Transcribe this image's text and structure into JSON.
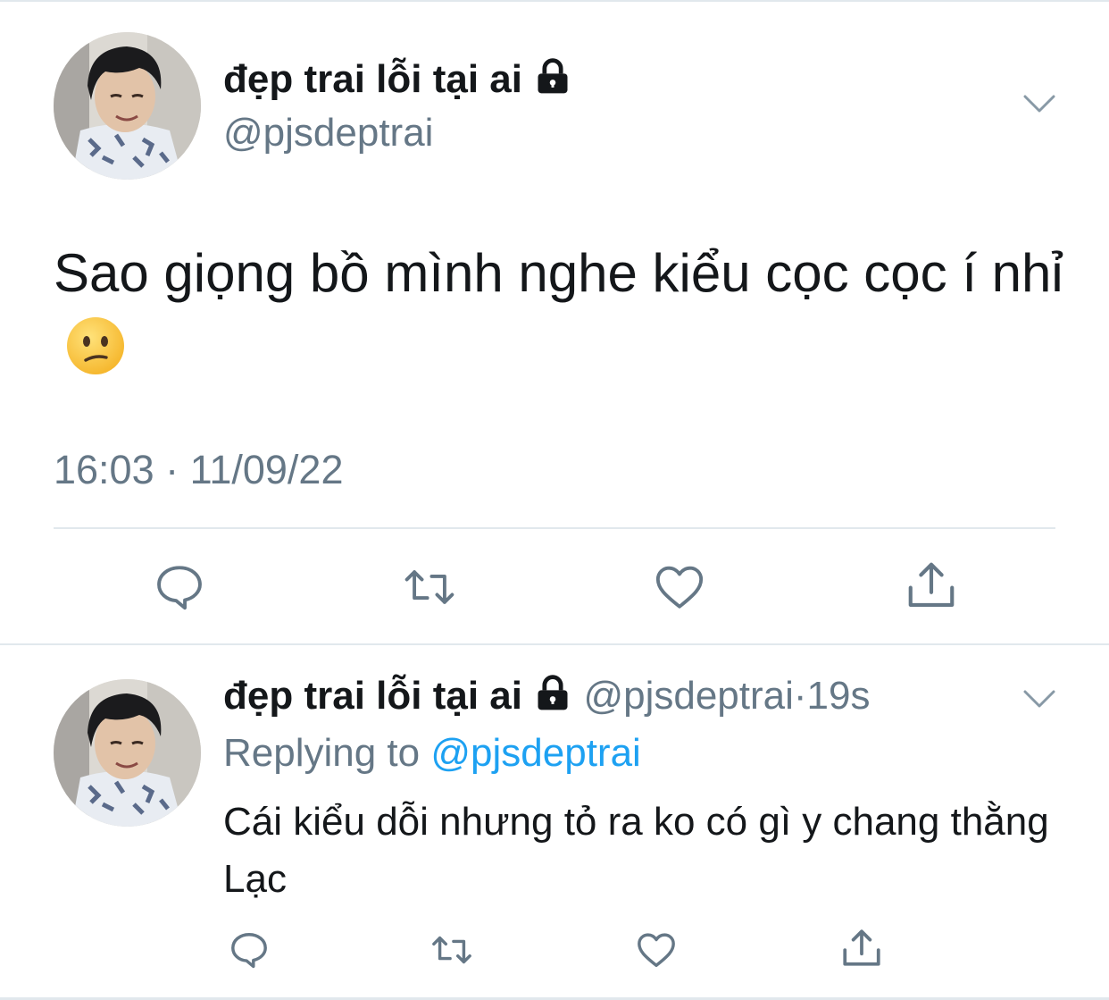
{
  "main_tweet": {
    "author_name": "đẹp trai lỗi tại ai",
    "author_handle": "@pjsdeptrai",
    "text": "Sao giọng bồ mình nghe kiểu cọc cọc í nhỉ",
    "emoji": "confused-face",
    "time": "16:03",
    "date": "11/09/22",
    "separator": "·",
    "actions": [
      "reply-icon",
      "retweet-icon",
      "like-icon",
      "share-icon"
    ]
  },
  "reply_tweet": {
    "author_name": "đẹp trai lỗi tại ai",
    "author_handle": "@pjsdeptrai",
    "separator": "·",
    "age": "19s",
    "replying_prefix": "Replying to",
    "replying_to": "@pjsdeptrai",
    "text": "Cái kiểu dỗi nhưng tỏ ra ko có gì y chang thằng Lạc",
    "actions": [
      "reply-icon",
      "retweet-icon",
      "like-icon",
      "share-icon"
    ]
  },
  "colors": {
    "text_primary": "#14171a",
    "text_secondary": "#657786",
    "accent": "#1da1f2",
    "divider": "#e1e8ed",
    "icon": "#657786"
  }
}
